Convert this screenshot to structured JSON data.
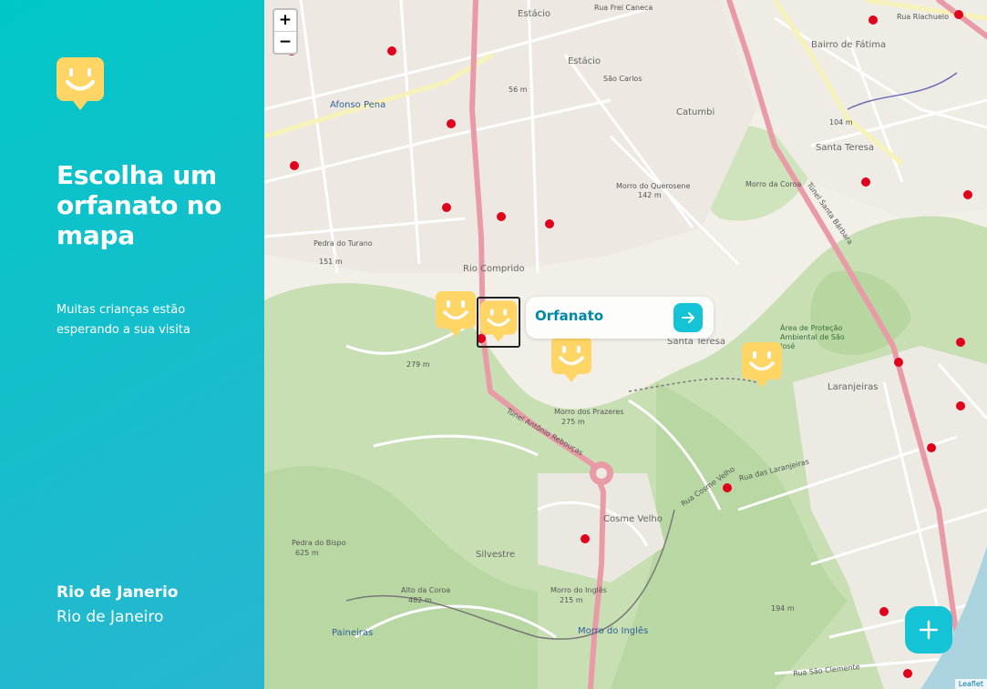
{
  "sidebar": {
    "logo_icon": "happy-face-pin-icon",
    "title": "Escolha um orfanato no mapa",
    "subtitle": "Muitas crianças estão esperando a sua visita",
    "footer": {
      "state": "Rio de Janerio",
      "city": "Rio de Janeiro"
    }
  },
  "map": {
    "zoom_in": "+",
    "zoom_out": "−",
    "attribution": "Leaflet",
    "labels": {
      "estacio_top": "Estácio",
      "estacio": "Estácio",
      "sao_carlos": "São Carlos",
      "catumbi": "Catumbi",
      "santa_teresa_top": "Santa Teresa",
      "santa_teresa": "Santa Teresa",
      "bairro_fatima": "Bairro de Fátima",
      "afonso_pena": "Afonso Pena",
      "rio_comprido": "Rio Comprido",
      "cosme_velho": "Cosme Velho",
      "silvestre": "Silvestre",
      "paineiras": "Paineiras",
      "laranjeiras": "Laranjeiras",
      "morro_do_ingles": "Morro do Inglês",
      "morro_queromene": "Morro do Querosene",
      "morro_queromene_alt": "142 m",
      "morro_turano": "Pedra do Turano",
      "morro_turano_alt": "151 m",
      "morro_coroa": "Morro da Coroa",
      "morro_prazeres": "Morro dos Prazeres",
      "morro_prazeres_alt": "275 m",
      "pedra_bispo": "Pedra do Bispo",
      "pedra_bispo_alt": "625 m",
      "alto_coroa": "Alto da Coroa",
      "alto_coroa_alt": "482 m",
      "morro_ingles_peak": "Morro do Inglês",
      "morro_ingles_alt": "215 m",
      "area_protecao": "Área de Proteção Ambiental de São José",
      "rua_frei_caneca": "Rua Frei Caneca",
      "rua_riachuelo": "Rua Riachuelo",
      "tunel_santa_barbara": "Túnel Santa Bárbara",
      "tunel_reboucas": "Túnel Antônio Rebouças",
      "rua_das_laranjeiras": "Rua das Laranjeiras",
      "rua_cosme_velho": "Rua Cosme Velho",
      "rua_sao_clemente": "Rua São Clemente",
      "alt_56": "56 m",
      "alt_104": "104 m",
      "alt_279": "279 m",
      "alt_194": "194 m"
    }
  },
  "popup": {
    "name": "Orfanato",
    "button_icon": "arrow-right-icon"
  },
  "create_button": {
    "icon": "plus-icon"
  },
  "colors": {
    "sidebar_gradient_start": "#29B6D1",
    "sidebar_gradient_end": "#00C7C7",
    "marker_yellow": "#FFD666",
    "accent": "#15C3D6",
    "popup_text": "#0089A5"
  }
}
